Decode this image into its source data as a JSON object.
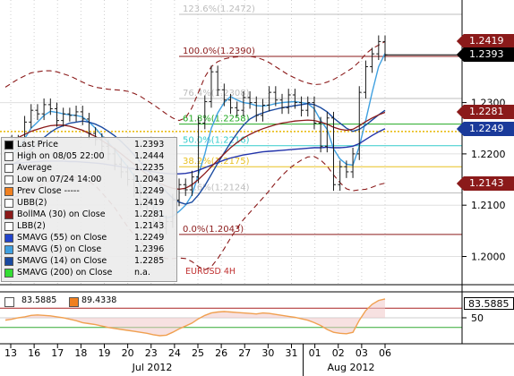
{
  "colors": {
    "background": "#ffffff",
    "price_line": "#1a1a1a",
    "fib": "#b03030",
    "upper_band": "#8b1a1a",
    "boll_ma": "#8b1a1a",
    "smavg55": "#2233aa",
    "smavg5": "#3fa0e0",
    "smavg14": "#1a4aa0",
    "fib_618": "#22aa22",
    "fib_50": "#33cccc",
    "fib_382": "#e8c020",
    "osc_line": "#f0a050"
  },
  "chart_data": {
    "type": "line",
    "title": "EURUSD 4H",
    "y_range": [
      1.1945,
      1.25
    ],
    "y_ticks": [
      "1.2000",
      "1.2100",
      "1.2200",
      "1.2300"
    ],
    "x_day_labels": [
      "13",
      "16",
      "17",
      "18",
      "19",
      "20",
      "23",
      "24",
      "25",
      "26",
      "27",
      "30",
      "31",
      "01",
      "02",
      "03",
      "06"
    ],
    "x_month_labels": [
      "Jul 2012",
      "Aug 2012"
    ],
    "fib_levels": [
      {
        "label": "123.6%(1.2472)",
        "value": 1.2472
      },
      {
        "label": "100.0%(1.2390)",
        "value": 1.239
      },
      {
        "label": "76.4%(1.2308)",
        "value": 1.2308
      },
      {
        "label": "61.8%(1.2258)",
        "value": 1.2258
      },
      {
        "label": "50.0%(1.2216)",
        "value": 1.2216
      },
      {
        "label": "38.2%(1.2175)",
        "value": 1.2175
      },
      {
        "label": "23.6%(1.2124)",
        "value": 1.2124
      },
      {
        "label": "0.0%(1.2043)",
        "value": 1.2043
      }
    ],
    "price_tags": [
      {
        "value": 1.2419,
        "text": "1.2419",
        "bg": "#8b1a1a"
      },
      {
        "value": 1.2393,
        "text": "1.2393",
        "bg": "#000000"
      },
      {
        "value": 1.2281,
        "text": "1.2281",
        "bg": "#8b1a1a"
      },
      {
        "value": 1.2249,
        "text": "1.2249",
        "bg": "#1a3a9a"
      },
      {
        "value": 1.2143,
        "text": "1.2143",
        "bg": "#8b1a1a"
      }
    ],
    "series": [
      {
        "name": "Last Price",
        "values": [
          1.22,
          1.2225,
          1.2212,
          1.2262,
          1.2285,
          1.2278,
          1.2296,
          1.2288,
          1.2265,
          1.2278,
          1.2275,
          1.2282,
          1.2268,
          1.224,
          1.2228,
          1.2215,
          1.22,
          1.218,
          1.2165,
          1.215,
          1.2128,
          1.2105,
          1.2085,
          1.2068,
          1.2055,
          1.2068,
          1.211,
          1.214,
          1.213,
          1.2155,
          1.226,
          1.2302,
          1.236,
          1.2325,
          1.2305,
          1.229,
          1.2285,
          1.231,
          1.23,
          1.2275,
          1.2295,
          1.232,
          1.2305,
          1.229,
          1.2315,
          1.23,
          1.2285,
          1.23,
          1.226,
          1.2215,
          1.227,
          1.214,
          1.2175,
          1.2165,
          1.22,
          1.232,
          1.237,
          1.2395,
          1.2419,
          1.2393
        ]
      },
      {
        "name": "SMAVG (5) on Close",
        "values": [
          1.219,
          1.22,
          1.221,
          1.223,
          1.225,
          1.2262,
          1.2275,
          1.2283,
          1.2281,
          1.2278,
          1.2276,
          1.2275,
          1.2272,
          1.2262,
          1.225,
          1.2236,
          1.2222,
          1.2208,
          1.219,
          1.2175,
          1.2157,
          1.2138,
          1.2118,
          1.21,
          1.2085,
          1.2075,
          1.2078,
          1.2088,
          1.21,
          1.212,
          1.216,
          1.22,
          1.225,
          1.228,
          1.23,
          1.2312,
          1.2305,
          1.23,
          1.2298,
          1.2294,
          1.2293,
          1.2295,
          1.2298,
          1.23,
          1.2301,
          1.2302,
          1.23,
          1.2298,
          1.2288,
          1.2265,
          1.2248,
          1.221,
          1.219,
          1.218,
          1.2178,
          1.2215,
          1.2265,
          1.232,
          1.237,
          1.2396
        ]
      },
      {
        "name": "SMAVG (14) on Close",
        "values": [
          1.217,
          1.2178,
          1.2186,
          1.2196,
          1.2208,
          1.222,
          1.2232,
          1.2242,
          1.225,
          1.2255,
          1.226,
          1.2262,
          1.2264,
          1.2262,
          1.2258,
          1.2252,
          1.2244,
          1.2235,
          1.2224,
          1.2212,
          1.2198,
          1.2184,
          1.217,
          1.2155,
          1.214,
          1.2126,
          1.2114,
          1.2106,
          1.2102,
          1.2106,
          1.212,
          1.2138,
          1.216,
          1.2182,
          1.2202,
          1.2222,
          1.224,
          1.2256,
          1.2268,
          1.2275,
          1.228,
          1.2284,
          1.2287,
          1.229,
          1.2292,
          1.2294,
          1.2296,
          1.2298,
          1.2296,
          1.229,
          1.2282,
          1.227,
          1.226,
          1.225,
          1.2244,
          1.2248,
          1.2256,
          1.2266,
          1.2276,
          1.2285
        ]
      },
      {
        "name": "SMAVG (55) on Close",
        "values": [
          1.218,
          1.2181,
          1.2182,
          1.2183,
          1.2184,
          1.2185,
          1.2186,
          1.2186,
          1.2186,
          1.2186,
          1.2185,
          1.2185,
          1.2184,
          1.2183,
          1.2182,
          1.2181,
          1.2179,
          1.2177,
          1.2175,
          1.2173,
          1.2171,
          1.2169,
          1.2167,
          1.2165,
          1.2163,
          1.2162,
          1.2161,
          1.2161,
          1.2162,
          1.2164,
          1.2168,
          1.2173,
          1.2178,
          1.2183,
          1.2188,
          1.2192,
          1.2195,
          1.2198,
          1.22,
          1.2202,
          1.2204,
          1.2205,
          1.2206,
          1.2207,
          1.2208,
          1.2209,
          1.221,
          1.2211,
          1.2212,
          1.2212,
          1.2213,
          1.2212,
          1.2212,
          1.2213,
          1.2215,
          1.222,
          1.2228,
          1.2236,
          1.2243,
          1.2249
        ]
      },
      {
        "name": "UBB(2)",
        "values": [
          1.233,
          1.2338,
          1.2346,
          1.2352,
          1.2358,
          1.236,
          1.2362,
          1.2362,
          1.236,
          1.2356,
          1.2352,
          1.2346,
          1.234,
          1.2334,
          1.233,
          1.2328,
          1.2326,
          1.2325,
          1.2324,
          1.2322,
          1.2318,
          1.2312,
          1.2304,
          1.2296,
          1.2287,
          1.2278,
          1.227,
          1.2265,
          1.227,
          1.229,
          1.232,
          1.235,
          1.237,
          1.238,
          1.2385,
          1.2388,
          1.2389,
          1.239,
          1.239,
          1.2388,
          1.2384,
          1.2378,
          1.237,
          1.2362,
          1.2354,
          1.2348,
          1.2342,
          1.2338,
          1.2335,
          1.2336,
          1.234,
          1.2345,
          1.2352,
          1.236,
          1.2368,
          1.238,
          1.2395,
          1.2405,
          1.2412,
          1.2419
        ]
      },
      {
        "name": "BollMA (30) on Close",
        "values": [
          1.222,
          1.2226,
          1.2232,
          1.2238,
          1.2244,
          1.2248,
          1.2252,
          1.2255,
          1.2256,
          1.2256,
          1.2254,
          1.225,
          1.2246,
          1.224,
          1.2234,
          1.2226,
          1.2218,
          1.221,
          1.22,
          1.219,
          1.218,
          1.217,
          1.216,
          1.2151,
          1.2143,
          1.2137,
          1.2133,
          1.2131,
          1.2133,
          1.214,
          1.215,
          1.2162,
          1.2175,
          1.2188,
          1.22,
          1.2212,
          1.2222,
          1.2231,
          1.2238,
          1.2244,
          1.2249,
          1.2253,
          1.2257,
          1.226,
          1.2262,
          1.2264,
          1.2265,
          1.2266,
          1.2265,
          1.2262,
          1.2258,
          1.2252,
          1.2248,
          1.2246,
          1.2248,
          1.2255,
          1.2263,
          1.227,
          1.2276,
          1.2281
        ]
      },
      {
        "name": "LBB(2)",
        "values": [
          1.211,
          1.2114,
          1.2118,
          1.2124,
          1.213,
          1.2136,
          1.2142,
          1.2148,
          1.2152,
          1.2156,
          1.2156,
          1.2154,
          1.2152,
          1.2146,
          1.2138,
          1.2124,
          1.211,
          1.2095,
          1.2076,
          1.2058,
          1.2042,
          1.2028,
          1.2016,
          1.2006,
          1.1999,
          1.1996,
          1.1996,
          1.1997,
          1.1996,
          1.199,
          1.198,
          1.1974,
          1.198,
          1.1996,
          1.2015,
          1.2036,
          1.2055,
          1.2072,
          1.2086,
          1.21,
          1.2114,
          1.2128,
          1.2144,
          1.2158,
          1.217,
          1.218,
          1.2188,
          1.2194,
          1.2195,
          1.2188,
          1.2176,
          1.2159,
          1.2144,
          1.2132,
          1.2128,
          1.213,
          1.2131,
          1.2135,
          1.214,
          1.2143
        ]
      }
    ],
    "oscillator": {
      "y_range": [
        0,
        100
      ],
      "y_ticks": [
        "50"
      ],
      "ref_lines": [
        30,
        50,
        70
      ],
      "values": [
        45,
        47,
        50,
        52,
        55,
        56,
        55,
        54,
        52,
        50,
        47,
        44,
        40,
        38,
        36,
        33,
        30,
        28,
        26,
        24,
        22,
        20,
        18,
        15,
        13,
        14,
        20,
        27,
        33,
        39,
        48,
        55,
        60,
        62,
        63,
        62,
        61,
        60,
        59,
        58,
        60,
        59,
        57,
        55,
        53,
        51,
        48,
        45,
        40,
        34,
        26,
        20,
        18,
        17,
        20,
        45,
        65,
        78,
        86,
        89
      ]
    }
  },
  "legend": {
    "rows": [
      {
        "label": "Last Price",
        "value": "1.2393",
        "color": "#000000"
      },
      {
        "label": "High on 08/05 22:00",
        "value": "1.2444",
        "color": "#ffffff"
      },
      {
        "label": "Average",
        "value": "1.2235",
        "color": "#ffffff"
      },
      {
        "label": "Low on 07/24 14:00",
        "value": "1.2043",
        "color": "#ffffff"
      },
      {
        "label": "Prev Close -----",
        "value": "1.2249",
        "color": "#f08020"
      },
      {
        "label": "UBB(2)",
        "value": "1.2419",
        "color": "#ffffff"
      },
      {
        "label": "BollMA (30) on Close",
        "value": "1.2281",
        "color": "#8b1a1a"
      },
      {
        "label": "LBB(2)",
        "value": "1.2143",
        "color": "#ffffff"
      },
      {
        "label": "SMAVG (55) on Close",
        "value": "1.2249",
        "color": "#2244cc"
      },
      {
        "label": "SMAVG (5) on Close",
        "value": "1.2396",
        "color": "#3fa0e0"
      },
      {
        "label": "SMAVG (14) on Close",
        "value": "1.2285",
        "color": "#1a4aa0"
      },
      {
        "label": "SMAVG (200) on Close",
        "value": "n.a.",
        "color": "#33dd33"
      }
    ]
  },
  "oscillator_legend": {
    "value1": "83.5885",
    "value2": "89.4338",
    "tag": "83.5885",
    "swatch_color": "#f08020"
  }
}
